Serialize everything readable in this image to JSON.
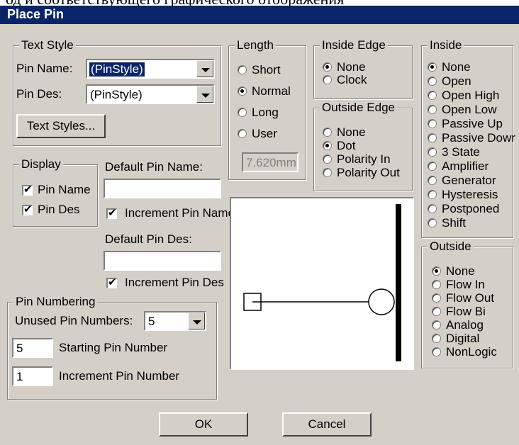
{
  "doc_strip_text": "од и соответствующего графического отображения",
  "window": {
    "title": "Place Pin"
  },
  "text_style": {
    "legend": "Text Style",
    "pin_name_label": "Pin Name:",
    "pin_name_value": "(PinStyle)",
    "pin_des_label": "Pin Des:",
    "pin_des_value": "(PinStyle)",
    "text_styles_button": "Text Styles..."
  },
  "length": {
    "legend": "Length",
    "options": [
      {
        "label": "Short",
        "selected": false
      },
      {
        "label": "Normal",
        "selected": true
      },
      {
        "label": "Long",
        "selected": false
      },
      {
        "label": "User",
        "selected": false
      }
    ],
    "user_value": "7.620mm"
  },
  "inside_edge": {
    "legend": "Inside Edge",
    "options": [
      {
        "label": "None",
        "selected": true
      },
      {
        "label": "Clock",
        "selected": false
      }
    ]
  },
  "outside_edge": {
    "legend": "Outside Edge",
    "options": [
      {
        "label": "None",
        "selected": false
      },
      {
        "label": "Dot",
        "selected": true
      },
      {
        "label": "Polarity In",
        "selected": false
      },
      {
        "label": "Polarity Out",
        "selected": false
      }
    ]
  },
  "inside": {
    "legend": "Inside",
    "options": [
      {
        "label": "None",
        "selected": true
      },
      {
        "label": "Open",
        "selected": false
      },
      {
        "label": "Open High",
        "selected": false
      },
      {
        "label": "Open Low",
        "selected": false
      },
      {
        "label": "Passive Up",
        "selected": false
      },
      {
        "label": "Passive Dowr",
        "selected": false
      },
      {
        "label": "3 State",
        "selected": false
      },
      {
        "label": "Amplifier",
        "selected": false
      },
      {
        "label": "Generator",
        "selected": false
      },
      {
        "label": "Hysteresis",
        "selected": false
      },
      {
        "label": "Postponed",
        "selected": false
      },
      {
        "label": "Shift",
        "selected": false
      }
    ]
  },
  "outside": {
    "legend": "Outside",
    "options": [
      {
        "label": "None",
        "selected": true
      },
      {
        "label": "Flow In",
        "selected": false
      },
      {
        "label": "Flow Out",
        "selected": false
      },
      {
        "label": "Flow Bi",
        "selected": false
      },
      {
        "label": "Analog",
        "selected": false
      },
      {
        "label": "Digital",
        "selected": false
      },
      {
        "label": "NonLogic",
        "selected": false
      }
    ]
  },
  "display": {
    "legend": "Display",
    "pin_name": {
      "label": "Pin Name",
      "checked": true
    },
    "pin_des": {
      "label": "Pin Des",
      "checked": true
    }
  },
  "defaults": {
    "pin_name_label": "Default Pin Name:",
    "pin_name_value": "",
    "increment_pin_name": {
      "label": "Increment Pin Name",
      "checked": true
    },
    "pin_des_label": "Default Pin Des:",
    "pin_des_value": "",
    "increment_pin_des": {
      "label": "Increment Pin Des",
      "checked": true
    }
  },
  "pin_numbering": {
    "legend": "Pin Numbering",
    "unused_label": "Unused Pin Numbers:",
    "unused_value": "5",
    "starting_value": "5",
    "starting_label": "Starting Pin Number",
    "increment_value": "1",
    "increment_label": "Increment Pin Number"
  },
  "buttons": {
    "ok": "OK",
    "cancel": "Cancel"
  }
}
